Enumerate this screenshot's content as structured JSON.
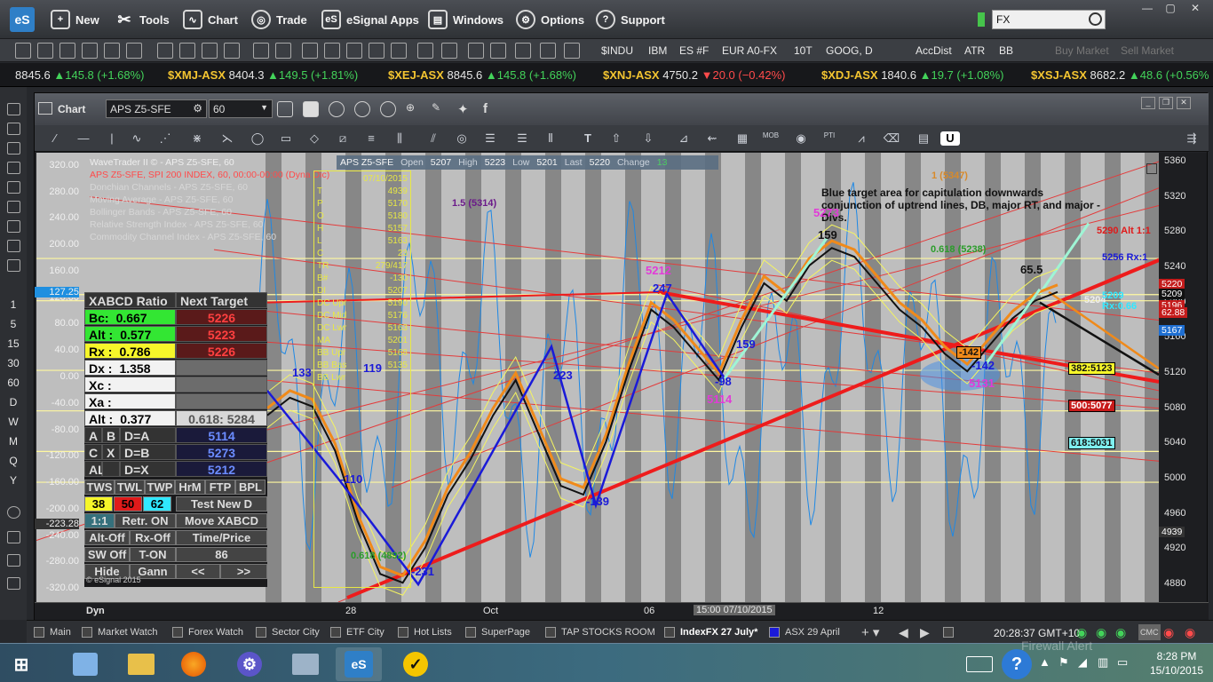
{
  "app": {
    "logo_text": "eS"
  },
  "menu": [
    {
      "label": "New",
      "icon": "new-window-icon"
    },
    {
      "label": "Tools",
      "icon": "tools-icon"
    },
    {
      "label": "Chart",
      "icon": "chart-icon"
    },
    {
      "label": "Trade",
      "icon": "globe-icon"
    },
    {
      "label": "eSignal Apps",
      "icon": "esignal-apps-icon"
    },
    {
      "label": "Windows",
      "icon": "windows-icon"
    },
    {
      "label": "Options",
      "icon": "gear-icon"
    },
    {
      "label": "Support",
      "icon": "help-icon"
    }
  ],
  "search": {
    "value": "FX"
  },
  "quick_symbols": [
    "$INDU",
    "IBM",
    "ES #F",
    "EUR A0-FX",
    "10T",
    "GOOG, D",
    "AccDist",
    "ATR",
    "BB"
  ],
  "trade_buttons": [
    "Buy Market",
    "Sell Market"
  ],
  "ticker": [
    {
      "name": "",
      "price": "8845.6",
      "change": "▲145.8 (+1.68%)",
      "dir": "up"
    },
    {
      "name": "$XMJ-ASX",
      "price": "8404.3",
      "change": "▲149.5 (+1.81%)",
      "dir": "up"
    },
    {
      "name": "$XEJ-ASX",
      "price": "8845.6",
      "change": "▲145.8 (+1.68%)",
      "dir": "up"
    },
    {
      "name": "$XNJ-ASX",
      "price": "4750.2",
      "change": "▼20.0 (−0.42%)",
      "dir": "down"
    },
    {
      "name": "$XDJ-ASX",
      "price": "1840.6",
      "change": "▲19.7 (+1.08%)",
      "dir": "up"
    },
    {
      "name": "$XSJ-ASX",
      "price": "8682.2",
      "change": "▲48.6 (+0.56%",
      "dir": "up"
    }
  ],
  "left_intervals": [
    "1",
    "5",
    "15",
    "30",
    "60",
    "D",
    "W",
    "M",
    "Q",
    "Y"
  ],
  "chart": {
    "title": "Chart",
    "symbol": "APS Z5-SFE",
    "interval": "60",
    "legend": [
      "WaveTrader II © - APS Z5-SFE, 60",
      "APS Z5-SFE, SPI 200 INDEX, 60, 00:00-00:00 (Dyna Dic)",
      "Donchian Channels - APS Z5-SFE, 60",
      "Moving Average - APS Z5-SFE, 60",
      "Bollinger Bands - APS Z5-SFE, 60",
      "Relative Strength Index - APS Z5-SFE, 60",
      "Commodity Channel Index - APS Z5-SFE, 60"
    ],
    "quote": {
      "symbol": "APS Z5-SFE",
      "open_label": "Open",
      "open": "5207",
      "high_label": "High",
      "high": "5223",
      "low_label": "Low",
      "low": "5201",
      "last_label": "Last",
      "last": "5220",
      "change_label": "Change",
      "change": "13"
    },
    "annotation": "Blue target area for capitulation downwards conjunction of uptrend lines, DB, major RT, and major -Divs.",
    "price_axis": [
      "5360",
      "5320",
      "5280",
      "5240",
      "5200",
      "5160",
      "5120",
      "5080",
      "5040",
      "5000",
      "4960",
      "4920",
      "4880"
    ],
    "price_tags": [
      {
        "text": "5220",
        "color": "#c41c1c"
      },
      {
        "text": "5209",
        "color": "#111111"
      },
      {
        "text": "5196",
        "color": "#c41c1c"
      },
      {
        "text": "62.88",
        "color": "#c41c1c"
      },
      {
        "text": "5167",
        "color": "#1f6fd2"
      },
      {
        "text": "4939",
        "color": "#333333"
      }
    ],
    "cci_axis": [
      "320.00",
      "280.00",
      "240.00",
      "200.00",
      "160.00",
      "120.00",
      "80.00",
      "40.00",
      "0.00",
      "-40.00",
      "-80.00",
      "-120.00",
      "-160.00",
      "-200.00",
      "-240.00",
      "-280.00",
      "-320.00"
    ],
    "cci_tags": [
      {
        "text": "127.25",
        "color": "#1f8fe0"
      },
      {
        "text": "-223.28",
        "color": "#333333"
      }
    ],
    "time_axis": [
      "28",
      "Oct",
      "06",
      "15:00 07/10/2015",
      "12"
    ],
    "dyn_label": "Dyn",
    "wave_labels": [
      {
        "text": "133",
        "color": "#1a1ad8"
      },
      {
        "text": "119",
        "color": "#1a1ad8"
      },
      {
        "text": "-110",
        "color": "#1a1ad8"
      },
      {
        "text": "-231",
        "color": "#1a1ad8"
      },
      {
        "text": "223",
        "color": "#1a1ad8"
      },
      {
        "text": "-139",
        "color": "#1a1ad8"
      },
      {
        "text": "247",
        "color": "#1a1ad8"
      },
      {
        "text": "5212",
        "color": "#e23ad8"
      },
      {
        "text": "-98",
        "color": "#1a1ad8"
      },
      {
        "text": "5114",
        "color": "#e23ad8"
      },
      {
        "text": "159",
        "color": "#1a1ad8"
      },
      {
        "text": "5273",
        "color": "#e23ad8"
      },
      {
        "text": "159",
        "color": "#111111"
      },
      {
        "text": "-142",
        "color": "#1a1ad8"
      },
      {
        "text": "5131",
        "color": "#e23ad8"
      },
      {
        "text": "65.5",
        "color": "#111111"
      }
    ],
    "target_labels": [
      {
        "text": "-142",
        "bg": "#f08a1a",
        "fg": "#111111"
      },
      {
        "text": "5290 Alt 1:1",
        "bg": "",
        "fg": "#e01a1a"
      },
      {
        "text": "5256 Rx:1",
        "bg": "",
        "fg": "#1a1ad8"
      },
      {
        "text": "5204",
        "bg": "",
        "fg": "#eeeeee"
      },
      {
        "text": "5209 Rx:0.66",
        "bg": "",
        "fg": "#30e8ff"
      },
      {
        "text": "382:5123",
        "bg": "#f6f62a",
        "fg": "#111111"
      },
      {
        "text": "500:5077",
        "bg": "#c81a1a",
        "fg": "#ffffff"
      },
      {
        "text": "618:5031",
        "bg": "#7ff0f0",
        "fg": "#111111"
      },
      {
        "text": "0.618 (5238)",
        "bg": "",
        "fg": "#2a9d2a"
      },
      {
        "text": "0.618 (4892)",
        "bg": "",
        "fg": "#2a9d2a"
      },
      {
        "text": "1.5 (5314)",
        "bg": "",
        "fg": "#6b1a8a"
      },
      {
        "text": "1 (5347)",
        "bg": "",
        "fg": "#d88a2a"
      }
    ],
    "data_window": {
      "date": "07/10/2015",
      "time": "15:00",
      "rows": [
        "4939",
        "5170",
        "5180",
        "5157",
        "5163",
        "23",
        "279/417",
        "-130",
        "5207",
        "5190",
        "5176",
        "5163",
        "5201",
        "5168",
        "5135"
      ],
      "labels": [
        "T",
        "P",
        "O",
        "H",
        "L",
        "C",
        "TR",
        "B#",
        "DI",
        "DC Upr",
        "DC Mid",
        "DC Lwr",
        "MA",
        "BB Upr",
        "BB Bas",
        "BB Lwr"
      ]
    }
  },
  "xabcd": {
    "header_left": "XABCD Ratio",
    "header_right": "Next Target",
    "rows": [
      {
        "label": "Bc:",
        "value": "0.667",
        "target": "5226",
        "color": "#33e633"
      },
      {
        "label": "Alt :",
        "value": "0.577",
        "target": "5223",
        "color": "#33e633"
      },
      {
        "label": "Rx :",
        "value": "0.786",
        "target": "5226",
        "color": "#f6f62a"
      },
      {
        "label": "Dx :",
        "value": "1.358",
        "target": "",
        "color": "#f2f2f2"
      },
      {
        "label": "Xc :",
        "value": "",
        "target": "",
        "color": "#f2f2f2"
      },
      {
        "label": "Xa :",
        "value": "",
        "target": "",
        "color": "#f2f2f2"
      },
      {
        "label": "Alt :",
        "value": "0.377",
        "target": "0.618: 5284",
        "color": "#f2f2f2"
      }
    ],
    "points": [
      {
        "a": "A",
        "b": "B",
        "c": "D=A",
        "v": "5114"
      },
      {
        "a": "C",
        "b": "X",
        "c": "D=B",
        "v": "5273"
      },
      {
        "a": "ALL",
        "b": "",
        "c": "D=X",
        "v": "5212"
      }
    ],
    "tw_buttons": [
      "TWS",
      "TWL",
      "TWP",
      "HrM",
      "FTP",
      "BPL"
    ],
    "counts": [
      {
        "v": "38",
        "bg": "#f6f62a"
      },
      {
        "v": "50",
        "bg": "#e01a1a"
      },
      {
        "v": "62",
        "bg": "#30e8ff"
      }
    ],
    "buttons": [
      "Test New D",
      "1:1",
      "Retr. ON",
      "Move XABCD",
      "Alt-Off",
      "Rx-Off",
      "Time/Price",
      "SW Off",
      "T-ON",
      "86",
      "Hide",
      "Gann",
      "<<",
      ">>"
    ],
    "copyright": "© eSignal 2015"
  },
  "tabs": [
    {
      "label": "Main",
      "active": false
    },
    {
      "label": "Market Watch",
      "active": false
    },
    {
      "label": "Forex Watch",
      "active": false
    },
    {
      "label": "Sector City",
      "active": false
    },
    {
      "label": "ETF City",
      "active": false
    },
    {
      "label": "Hot Lists",
      "active": false
    },
    {
      "label": "SuperPage",
      "active": false
    },
    {
      "label": "TAP STOCKS ROOM",
      "active": false
    },
    {
      "label": "IndexFX 27 July*",
      "active": true
    },
    {
      "label": "ASX 29 April",
      "active": false
    }
  ],
  "status_clock": "20:28:37 GMT+10",
  "taskbar": {
    "apps": [
      "start-button",
      "control-panel",
      "file-explorer",
      "firefox",
      "settings",
      "network",
      "esignal",
      "norton"
    ],
    "notification": "Firewall Alert",
    "time": "8:28 PM",
    "date": "15/10/2015"
  },
  "chart_data": {
    "type": "line",
    "title": "",
    "ylabel": "",
    "xlabel": "",
    "ylim": [
      4860,
      5370
    ],
    "cci_ylim": [
      -340,
      340
    ],
    "x": [
      "28",
      "Oct",
      "06",
      "12"
    ],
    "series": [
      {
        "name": "APS Z5-SFE",
        "values": [
          5080,
          5100,
          5090,
          5040,
          4960,
          4900,
          4890,
          4930,
          4990,
          5030,
          5080,
          5120,
          5060,
          5000,
          4990,
          5050,
          5130,
          5200,
          5180,
          5150,
          5120,
          5180,
          5230,
          5210,
          5250,
          5270,
          5260,
          5230,
          5200,
          5180,
          5150,
          5130,
          5160,
          5190,
          5210,
          5220
        ]
      }
    ],
    "levels": [
      {
        "label": "5256 Rx:1",
        "value": 5256
      },
      {
        "label": "5209 Rx:0.66",
        "value": 5209
      },
      {
        "label": "382:5123",
        "value": 5123
      },
      {
        "label": "500:5077",
        "value": 5077
      },
      {
        "label": "618:5031",
        "value": 5031
      }
    ]
  }
}
